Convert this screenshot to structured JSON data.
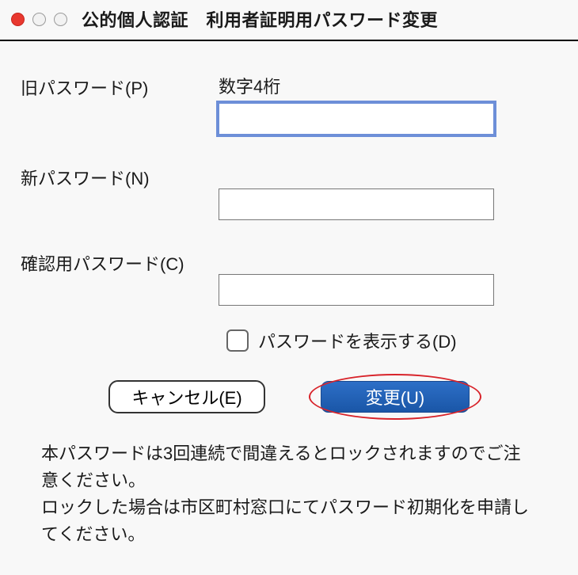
{
  "window": {
    "title": "公的個人認証　利用者証明用パスワード変更"
  },
  "fields": {
    "old": {
      "label": "旧パスワード(P)",
      "hint": "数字4桁",
      "value": ""
    },
    "new": {
      "label": "新パスワード(N)",
      "value": ""
    },
    "confirm": {
      "label": "確認用パスワード(C)",
      "value": ""
    }
  },
  "showPassword": {
    "label": "パスワードを表示する(D)",
    "checked": false
  },
  "buttons": {
    "cancel": "キャンセル(E)",
    "change": "変更(U)"
  },
  "warning": {
    "line1": "本パスワードは3回連続で間違えるとロックされますのでご注意ください。",
    "line2": "ロックした場合は市区町村窓口にてパスワード初期化を申請してください。"
  }
}
